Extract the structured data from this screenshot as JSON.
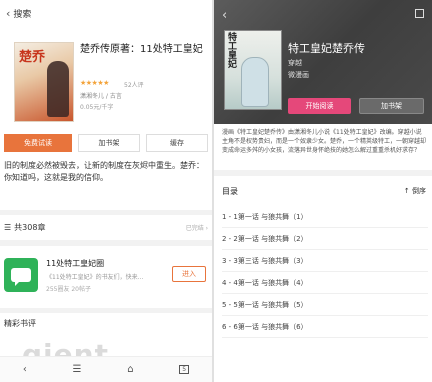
{
  "left": {
    "header": {
      "back_icon": "chevron-left-icon",
      "title": "搜索"
    },
    "book": {
      "cover_text": "楚乔",
      "title": "楚乔传原著：11处特工皇妃",
      "stars": "★★★★★",
      "rating_text": "52人评",
      "author": "潇湘冬儿 / 古言",
      "price": "0.05元/千字"
    },
    "actions": {
      "trial": "免费试读",
      "add_shelf": "加书架",
      "cache": "缓存"
    },
    "description": "旧的制度必然被毁去，让新的制度在灰烬中重生。楚乔：你知道吗，这就是我的信仰。",
    "chapters": {
      "icon": "list-icon",
      "count": "共308章",
      "status": "已完结 ›"
    },
    "circle": {
      "logo_icon": "chat-bubble-icon",
      "name": "11处特工皇妃圈",
      "desc": "《11处特工皇妃》的书友们，快来...",
      "stats": "255圈友  20帖子",
      "join": "进入"
    },
    "reviews_title": "精彩书评",
    "bottom_nav": {
      "back": "‹",
      "menu": "☰",
      "home": "⌂",
      "tabs": "5"
    },
    "watermark": "qient"
  },
  "right": {
    "header": {
      "back_icon": "chevron-left-icon",
      "share_icon": "share-icon"
    },
    "book": {
      "cover_text": "特工皇妃",
      "title": "特工皇妃楚乔传",
      "author": "穿越",
      "publisher": "微漫画"
    },
    "actions": {
      "read": "开始阅读",
      "add_shelf": "加书架"
    },
    "description": "漫画《特工皇妃楚乔传》由潇湘冬儿小说《11处特工皇妃》改编。穿越小说主角不是权势贵妇，而是一个奴隶少女。楚乔，一个精英级特工，一朝穿越却变成命运多舛的小女孩，流落异世身怀绝技的她怎么解过重重杀机好求存？",
    "toc": {
      "title": "目录",
      "order": "↑ 倒序",
      "chapters": [
        "1 - 1第一话 与狼共舞（1）",
        "2 - 2第一话 与狼共舞（2）",
        "3 - 3第三话 与狼共舞（3）",
        "4 - 4第一话 与狼共舞（4）",
        "5 - 5第一话 与狼共舞（5）",
        "6 - 6第一话 与狼共舞（6）"
      ]
    }
  },
  "colors": {
    "accent_orange": "#e8743c",
    "accent_pink": "#e5487a",
    "green": "#2fb259"
  }
}
